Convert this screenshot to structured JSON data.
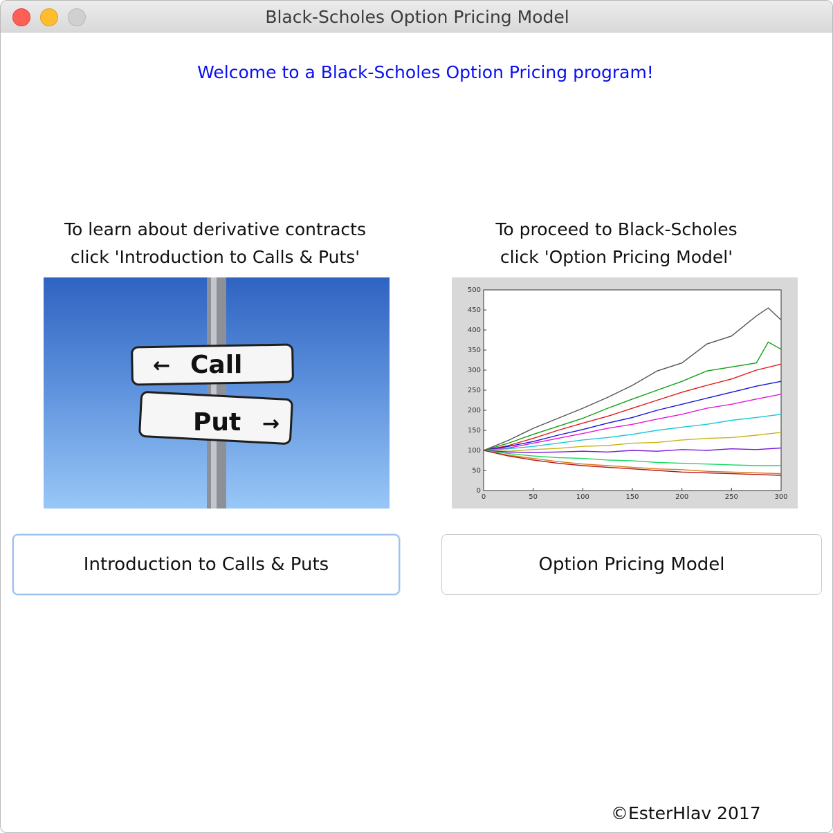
{
  "window": {
    "title": "Black-Scholes Option Pricing Model",
    "controls": [
      "close",
      "minimize",
      "zoom"
    ]
  },
  "welcome_text": "Welcome to a Black-Scholes Option Pricing program!",
  "left_panel": {
    "caption_line1": "To learn about derivative contracts",
    "caption_line2": "click 'Introduction to Calls & Puts'",
    "image": {
      "sign_call": "Call",
      "sign_put": "Put",
      "arrow_left": "←",
      "arrow_right": "→"
    },
    "button_label": "Introduction to Calls & Puts"
  },
  "right_panel": {
    "caption_line1": "To proceed to Black-Scholes",
    "caption_line2": "click 'Option Pricing Model'",
    "button_label": "Option Pricing Model"
  },
  "chart_data": {
    "type": "line",
    "title": "",
    "xlabel": "",
    "ylabel": "",
    "xlim": [
      0,
      300
    ],
    "ylim": [
      0,
      500
    ],
    "xticks": [
      "0",
      "50",
      "100",
      "150",
      "200",
      "250",
      "300"
    ],
    "yticks": [
      "0",
      "50",
      "100",
      "150",
      "200",
      "250",
      "300",
      "350",
      "400",
      "450",
      "500"
    ],
    "grid": false,
    "description_of_series": "many simulated price paths starting at 100",
    "series": [
      {
        "color": "#555555",
        "x": [
          0,
          25,
          50,
          75,
          100,
          125,
          150,
          175,
          200,
          225,
          250,
          275,
          287,
          300
        ],
        "y": [
          100,
          125,
          155,
          180,
          205,
          232,
          262,
          298,
          318,
          365,
          385,
          435,
          455,
          425
        ]
      },
      {
        "color": "#12a012",
        "x": [
          0,
          25,
          50,
          75,
          100,
          125,
          150,
          175,
          200,
          225,
          250,
          275,
          287,
          300
        ],
        "y": [
          100,
          118,
          140,
          160,
          180,
          205,
          228,
          250,
          272,
          298,
          308,
          318,
          370,
          352
        ]
      },
      {
        "color": "#e01818",
        "x": [
          0,
          25,
          50,
          75,
          100,
          125,
          150,
          175,
          200,
          225,
          250,
          275,
          300
        ],
        "y": [
          100,
          112,
          130,
          150,
          168,
          185,
          205,
          225,
          245,
          262,
          278,
          300,
          315
        ]
      },
      {
        "color": "#1515d8",
        "x": [
          0,
          25,
          50,
          75,
          100,
          125,
          150,
          175,
          200,
          225,
          250,
          275,
          300
        ],
        "y": [
          100,
          110,
          122,
          138,
          152,
          168,
          182,
          200,
          215,
          230,
          245,
          260,
          272
        ]
      },
      {
        "color": "#e816d8",
        "x": [
          0,
          25,
          50,
          75,
          100,
          125,
          150,
          175,
          200,
          225,
          250,
          275,
          300
        ],
        "y": [
          100,
          106,
          118,
          130,
          142,
          155,
          165,
          178,
          190,
          205,
          215,
          228,
          240
        ]
      },
      {
        "color": "#16c8d8",
        "x": [
          0,
          25,
          50,
          75,
          100,
          125,
          150,
          175,
          200,
          225,
          250,
          275,
          300
        ],
        "y": [
          100,
          104,
          110,
          118,
          126,
          132,
          140,
          150,
          158,
          165,
          175,
          182,
          190
        ]
      },
      {
        "color": "#c8b416",
        "x": [
          0,
          25,
          50,
          75,
          100,
          125,
          150,
          175,
          200,
          225,
          250,
          275,
          300
        ],
        "y": [
          100,
          98,
          102,
          105,
          110,
          112,
          118,
          120,
          126,
          130,
          132,
          138,
          145
        ]
      },
      {
        "color": "#7a16d8",
        "x": [
          0,
          25,
          50,
          75,
          100,
          125,
          150,
          175,
          200,
          225,
          250,
          275,
          300
        ],
        "y": [
          100,
          96,
          95,
          96,
          98,
          96,
          100,
          98,
          102,
          100,
          104,
          102,
          106
        ]
      },
      {
        "color": "#16d860",
        "x": [
          0,
          25,
          50,
          75,
          100,
          125,
          150,
          175,
          200,
          225,
          250,
          275,
          300
        ],
        "y": [
          100,
          92,
          86,
          82,
          80,
          76,
          74,
          70,
          68,
          66,
          64,
          62,
          62
        ]
      },
      {
        "color": "#d87a16",
        "x": [
          0,
          25,
          50,
          75,
          100,
          125,
          150,
          175,
          200,
          225,
          250,
          275,
          300
        ],
        "y": [
          100,
          88,
          80,
          72,
          66,
          62,
          58,
          54,
          52,
          48,
          46,
          44,
          42
        ]
      },
      {
        "color": "#b41616",
        "x": [
          0,
          25,
          50,
          75,
          100,
          125,
          150,
          175,
          200,
          225,
          250,
          275,
          300
        ],
        "y": [
          100,
          86,
          76,
          68,
          62,
          58,
          54,
          50,
          46,
          44,
          42,
          40,
          38
        ]
      }
    ]
  },
  "copyright": "©EsterHlav 2017"
}
